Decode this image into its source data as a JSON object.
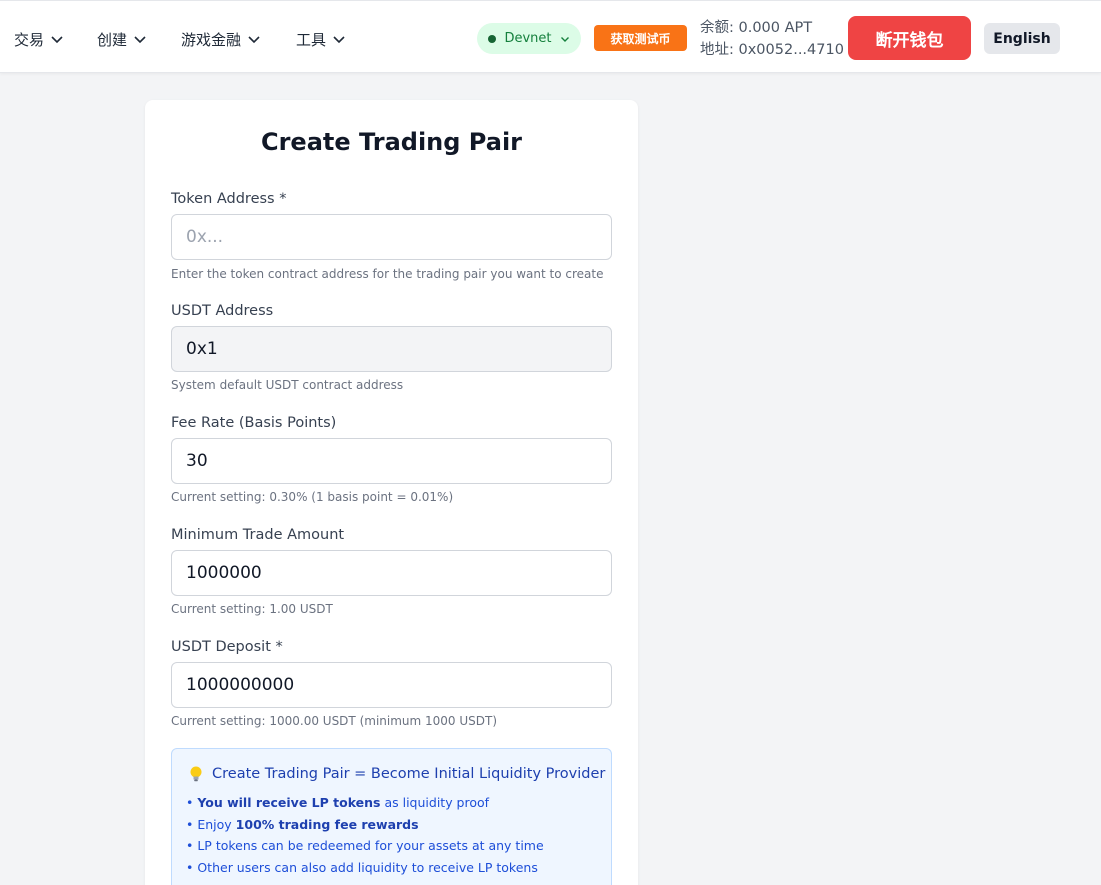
{
  "nav": {
    "items": [
      {
        "label": "交易"
      },
      {
        "label": "创建"
      },
      {
        "label": "游戏金融"
      },
      {
        "label": "工具"
      }
    ]
  },
  "network": {
    "label": "Devnet",
    "status_color": "#166534"
  },
  "faucet": {
    "label": "获取测试币"
  },
  "wallet": {
    "balance_label": "余额:",
    "balance": "0.000 APT",
    "address_label": "地址:",
    "address": "0x0052...4710"
  },
  "disconnect": {
    "label": "断开钱包"
  },
  "language": {
    "label": "English"
  },
  "form": {
    "title": "Create Trading Pair",
    "fields": [
      {
        "label": "Token Address *",
        "value": "",
        "placeholder": "0x...",
        "help": "Enter the token contract address for the trading pair you want to create"
      },
      {
        "label": "USDT Address",
        "value": "0x1",
        "placeholder": "",
        "help": "System default USDT contract address"
      },
      {
        "label": "Fee Rate (Basis Points)",
        "value": "30",
        "placeholder": "",
        "help": "Current setting: 0.30% (1 basis point = 0.01%)"
      },
      {
        "label": "Minimum Trade Amount",
        "value": "1000000",
        "placeholder": "",
        "help": "Current setting: 1.00 USDT"
      },
      {
        "label": "USDT Deposit *",
        "value": "1000000000",
        "placeholder": "",
        "help": "Current setting: 1000.00 USDT (minimum 1000 USDT)"
      }
    ]
  },
  "info": {
    "icon": "lightbulb-icon",
    "title": "Create Trading Pair = Become Initial Liquidity Provider",
    "line1_prefix": "• ",
    "line1_bold": "You will receive LP tokens",
    "line1_rest": " as liquidity proof",
    "line2_prefix": "• Enjoy ",
    "line2_bold": "100% trading fee rewards",
    "line3": "• LP tokens can be redeemed for your assets at any time",
    "line4": "• Other users can also add liquidity to receive LP tokens"
  },
  "colors": {
    "accent_danger": "#ef4444",
    "faucet_orange": "#f97316",
    "network_green_bg": "#dcfce7",
    "info_blue": "#1e40af"
  }
}
